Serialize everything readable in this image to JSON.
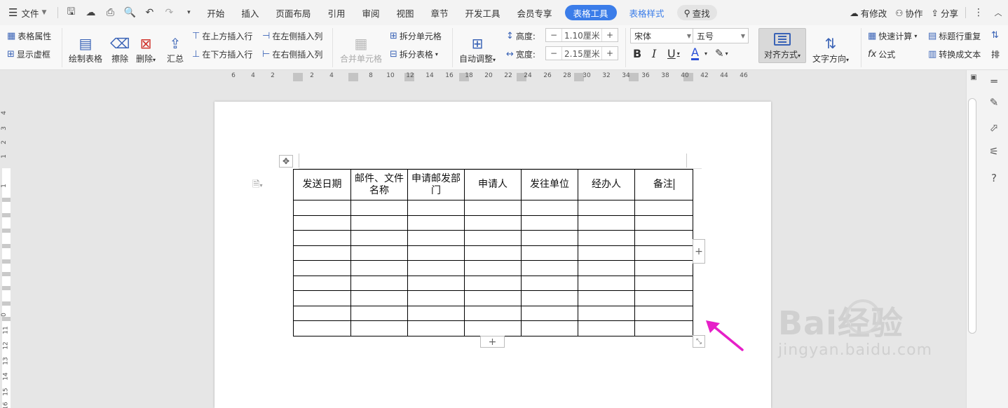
{
  "menubar": {
    "file_label": "文件",
    "tabs": [
      "开始",
      "插入",
      "页面布局",
      "引用",
      "审阅",
      "视图",
      "章节",
      "开发工具",
      "会员专享"
    ],
    "active_tab": "表格工具",
    "extra_tab": "表格样式",
    "search_label": "查找",
    "right_items": [
      "有修改",
      "协作",
      "分享"
    ]
  },
  "ribbon": {
    "table_props": "表格属性",
    "show_grid": "显示虚框",
    "draw_table": "绘制表格",
    "erase": "擦除",
    "delete": "删除",
    "summary": "汇总",
    "insert_above": "在上方插入行",
    "insert_below": "在下方插入行",
    "insert_left": "在左侧插入列",
    "insert_right": "在右侧插入列",
    "merge_cells": "合并单元格",
    "split_cells": "拆分单元格",
    "split_table": "拆分表格",
    "auto_fit": "自动调整",
    "height_label": "高度:",
    "height_value": "1.10厘米",
    "width_label": "宽度:",
    "width_value": "2.15厘米",
    "font_name": "宋体",
    "font_size": "五号",
    "align": "对齐方式",
    "text_dir": "文字方向",
    "quick_calc": "快速计算",
    "formula": "公式",
    "repeat_header": "标题行重复",
    "to_text": "转换成文本",
    "more": "排"
  },
  "ruler": {
    "h_ticks": [
      "6",
      "4",
      "2",
      "2",
      "4",
      "8",
      "10",
      "12",
      "14",
      "16",
      "18",
      "20",
      "22",
      "24",
      "26",
      "28",
      "30",
      "32",
      "34",
      "36",
      "38",
      "40",
      "42",
      "44",
      "46"
    ],
    "v_ticks": [
      "4",
      "3",
      "2",
      "1",
      "1",
      "0",
      "11",
      "12",
      "13",
      "14",
      "15",
      "16"
    ]
  },
  "table": {
    "headers": [
      "发送日期",
      "邮件、文件名称",
      "申请邮发部门",
      "申请人",
      "发往单位",
      "经办人",
      "备注"
    ],
    "rows": 9
  },
  "watermark": {
    "main": "Bai经验",
    "sub": "jingyan.baidu.com"
  },
  "colors": {
    "accent": "#3b7de9",
    "arrow": "#e61fc8"
  }
}
